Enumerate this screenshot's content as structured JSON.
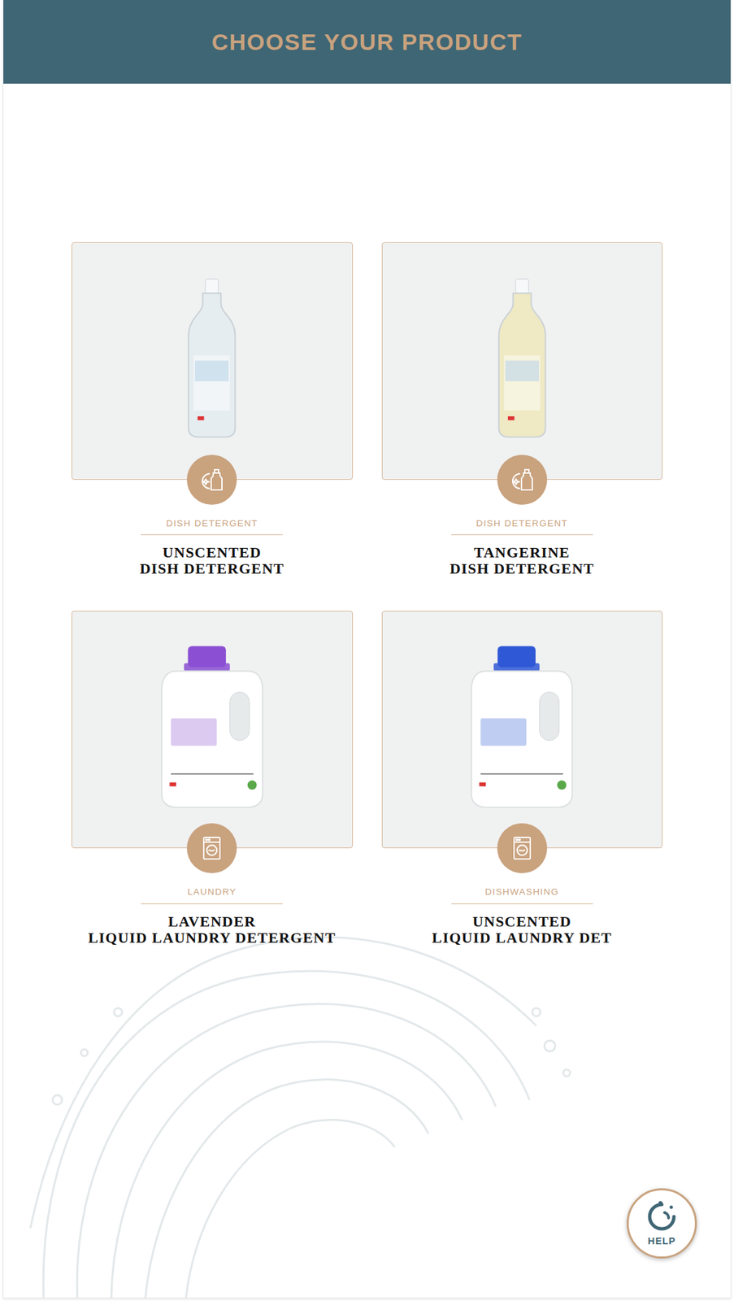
{
  "header": {
    "title": "CHOOSE YOUR PRODUCT"
  },
  "products": [
    {
      "category": "DISH DETERGENT",
      "title_lines": [
        "UNSCENTED",
        "DISH DETERGENT"
      ],
      "kind": "dish",
      "color": "#e6edf1"
    },
    {
      "category": "DISH DETERGENT",
      "title_lines": [
        "TANGERINE",
        "DISH DETERGENT"
      ],
      "kind": "dish",
      "color": "#efe9c4"
    },
    {
      "category": "LAUNDRY",
      "title_lines": [
        "LAVENDER",
        "LIQUID LAUNDRY DETERGENT"
      ],
      "kind": "laundry",
      "color": "#8a4fd2"
    },
    {
      "category": "DISHWASHING",
      "title_lines": [
        "UNSCENTED",
        "LIQUID LAUNDRY DET"
      ],
      "kind": "laundry",
      "color": "#2f58d6"
    }
  ],
  "help": {
    "label": "HELP"
  }
}
